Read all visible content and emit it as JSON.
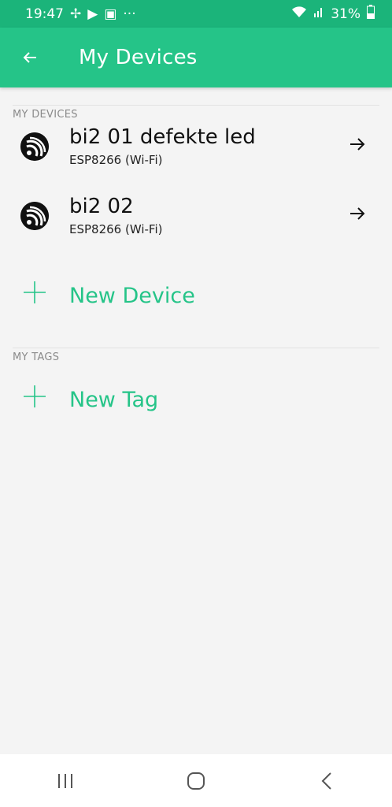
{
  "status_bar": {
    "time": "19:47",
    "battery": "31%"
  },
  "app_bar": {
    "title": "My Devices"
  },
  "sections": {
    "devices_header": "MY DEVICES",
    "tags_header": "MY TAGS"
  },
  "devices": [
    {
      "name": "bi2 01 defekte led",
      "type": "ESP8266 (Wi-Fi)"
    },
    {
      "name": "bi2 02",
      "type": "ESP8266 (Wi-Fi)"
    }
  ],
  "actions": {
    "new_device": "New Device",
    "new_tag": "New Tag"
  },
  "colors": {
    "accent": "#25c488",
    "status_bar": "#1bb47a",
    "background": "#f4f4f4"
  },
  "icons": {
    "back": "arrow-left-icon",
    "device": "espressif-icon",
    "open": "arrow-right-icon",
    "add": "plus-icon"
  }
}
